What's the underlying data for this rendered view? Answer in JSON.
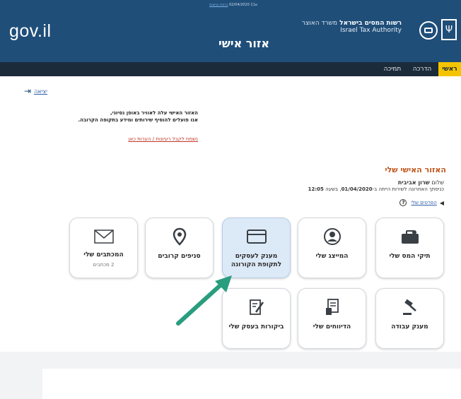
{
  "header": {
    "logo": "gov.il",
    "top_info": "ש11 02/04/2020",
    "top_link": "גרסת נגישות",
    "page_title": "אזור אישי",
    "authority_he_bold": "רשות המסים בישראל",
    "authority_he_light": "משרד האוצר",
    "authority_en": "Israel Tax Authority",
    "menorah_glyph": "Ψ"
  },
  "nav": {
    "items": [
      {
        "label": "ראשי",
        "active": true
      },
      {
        "label": "הדרכה",
        "active": false
      },
      {
        "label": "תמיכה",
        "active": false
      }
    ]
  },
  "logout": {
    "label": "יציאה",
    "icon": "logout-icon"
  },
  "notice": {
    "line1": "האזור האישי עלה לאוויר באופן נסיוני,",
    "line2": "אנו פועלים להוסיף שירותים ומידע בתקופה הקרובה.",
    "feedback_link": "נשמח לקבל רעיונות / הערות כאן"
  },
  "personal": {
    "title": "האזור האישי שלי",
    "greeting_prefix": "שלום",
    "user_name": "שרון אביבית",
    "last_login_prefix": "כניסתך האחרונה לשירות הייתה ב-",
    "last_login_date": "01/04/2020",
    "last_login_mid": ", בשעה ",
    "last_login_time": "12:05",
    "details_link": "הפרטים שלי",
    "help_glyph": "?"
  },
  "tiles": [
    {
      "label": "תיקי המס שלי",
      "sub": "",
      "icon": "folder-icon"
    },
    {
      "label": "המייצג שלי",
      "sub": "",
      "icon": "person-icon"
    },
    {
      "label": "מענק לעסקים לתקופת הקורונה",
      "sub": "",
      "icon": "credit-card-icon"
    },
    {
      "label": "סניפים קרובים",
      "sub": "",
      "icon": "location-icon"
    },
    {
      "label": "המכתבים שלי",
      "sub": "2 מכתבים",
      "icon": "envelope-icon"
    },
    {
      "label": "מענק עבודה",
      "sub": "",
      "icon": "gavel-icon"
    },
    {
      "label": "הדיווחים שלי",
      "sub": "",
      "icon": "report-icon"
    },
    {
      "label": "ביקורות בעסק שלי",
      "sub": "",
      "icon": "edit-document-icon"
    }
  ],
  "colors": {
    "header_bg": "#1f4e79",
    "nav_bg": "#1c2b3a",
    "nav_active": "#f5c400",
    "title_orange": "#c0541a",
    "arrow_green": "#2a9d7f",
    "highlight_tile": "#dce9f7"
  }
}
